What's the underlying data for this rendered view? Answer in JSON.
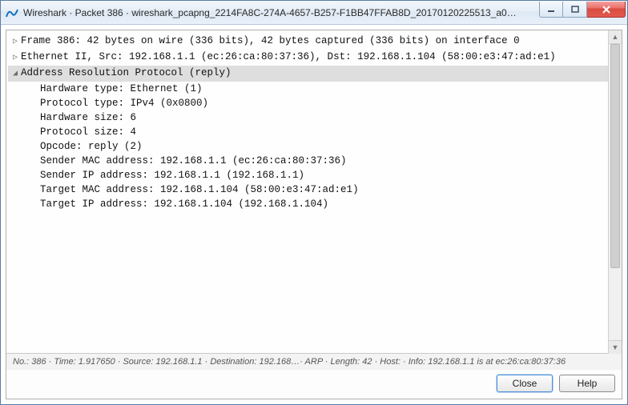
{
  "window": {
    "title": "Wireshark · Packet 386 · wireshark_pcapng_2214FA8C-274A-4657-B257-F1BB47FFAB8D_20170120225513_a0…"
  },
  "tree": {
    "frame": "Frame 386: 42 bytes on wire (336 bits), 42 bytes captured (336 bits) on interface 0",
    "ethernet": "Ethernet II, Src: 192.168.1.1 (ec:26:ca:80:37:36), Dst: 192.168.1.104 (58:00:e3:47:ad:e1)",
    "arp_header": "Address Resolution Protocol (reply)",
    "arp": {
      "hw_type": "Hardware type: Ethernet (1)",
      "proto_type": "Protocol type: IPv4 (0x0800)",
      "hw_size": "Hardware size: 6",
      "proto_size": "Protocol size: 4",
      "opcode": "Opcode: reply (2)",
      "sender_mac": "Sender MAC address: 192.168.1.1 (ec:26:ca:80:37:36)",
      "sender_ip": "Sender IP address: 192.168.1.1 (192.168.1.1)",
      "target_mac": "Target MAC address: 192.168.1.104 (58:00:e3:47:ad:e1)",
      "target_ip": "Target IP address: 192.168.1.104 (192.168.1.104)"
    }
  },
  "status": "No.: 386  ·  Time: 1.917650  ·  Source: 192.168.1.1  ·  Destination: 192.168…· ARP  ·  Length: 42  ·  Host:   ·  Info: 192.168.1.1 is at ec:26:ca:80:37:36",
  "buttons": {
    "close": "Close",
    "help": "Help"
  }
}
